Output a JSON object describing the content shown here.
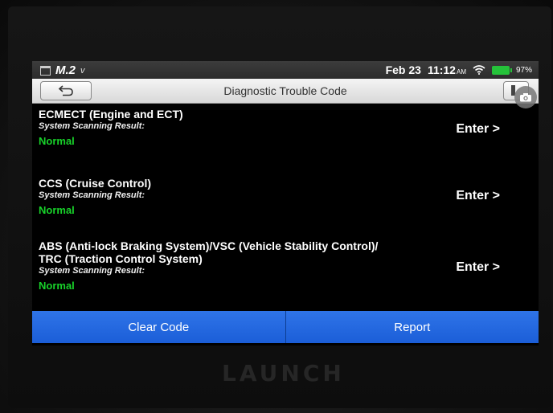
{
  "status_bar": {
    "brand": "M.2",
    "brand_suffix": "v",
    "date": "Feb 23",
    "time": "11:12",
    "ampm": "AM",
    "battery": "97%",
    "icons": [
      "calendar-icon",
      "wifi-icon",
      "battery-icon"
    ]
  },
  "header": {
    "title": "Diagnostic Trouble Code"
  },
  "systems": [
    {
      "name_line1": "ECMECT (Engine and ECT)",
      "name_line2": "",
      "result_label": "System Scanning Result:",
      "status": "Normal",
      "enter_label": "Enter >"
    },
    {
      "name_line1": "CCS (Cruise Control)",
      "name_line2": "",
      "result_label": "System Scanning Result:",
      "status": "Normal",
      "enter_label": "Enter >"
    },
    {
      "name_line1": "ABS (Anti-lock Braking System)/VSC (Vehicle Stability Control)/",
      "name_line2": "TRC (Traction Control System)",
      "result_label": "System Scanning Result:",
      "status": "Normal",
      "enter_label": "Enter >"
    }
  ],
  "footer": {
    "clear_code_label": "Clear Code",
    "report_label": "Report"
  },
  "device": {
    "logo_text": "LAUNCH"
  },
  "colors": {
    "status_normal": "#18d22a",
    "footer_bar": "#1f63dc",
    "battery": "#25c23a"
  }
}
